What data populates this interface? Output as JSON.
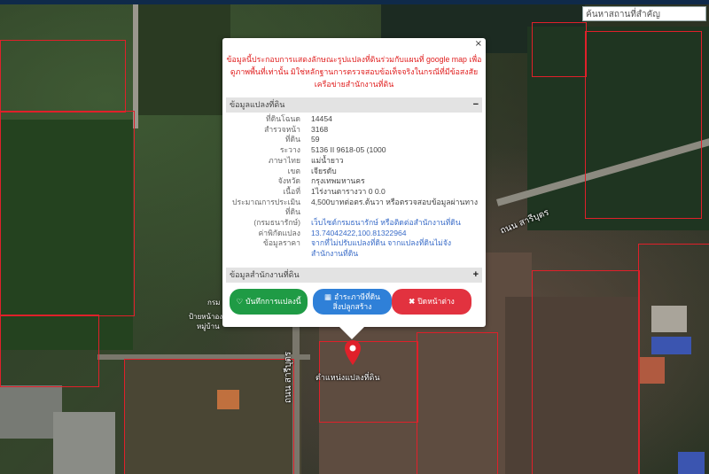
{
  "search": {
    "placeholder": "ค้นหาสถานที่สำคัญ"
  },
  "map": {
    "road_label_right": "ถนน สารีบุตร",
    "road_label_bottom": "ถนน สารีบุตร",
    "side_label_1": "กรม",
    "side_label_2": "ป้ายหน้าองค์การ",
    "side_label_3": "หมู่บ้าน",
    "marker_label": "ตำแหน่งแปลงที่ดิน",
    "marker_color": "#e0202a",
    "parcel_line_color": "#e0202a"
  },
  "popup": {
    "close": "×",
    "notice": "ข้อมูลนี้ประกอบการแสดงลักษณะรูปแปลงที่ดินร่วมกับแผนที่ google map เพื่อดูภาพพื้นที่เท่านั้น มิใช่หลักฐานการตรวจสอบข้อเท็จจริงในกรณีที่มีข้อสงสัยเครือข่ายสำนักงานที่ดิน",
    "section_info": {
      "title": "ข้อมูลแปลงที่ดิน",
      "toggle": "−"
    },
    "rows": [
      {
        "label": "ที่ดินโฉนด",
        "value": "14454"
      },
      {
        "label": "สำรวจหน้า",
        "value": "3168"
      },
      {
        "label": "ที่ดิน",
        "value": "59"
      },
      {
        "label": "ระวาง",
        "value": "5136 II 9618-05 (1000"
      },
      {
        "label": "ภาษาไทย",
        "value": "แม่น้ำยาว"
      },
      {
        "label": "เขต",
        "value": "เจียรดับ"
      },
      {
        "label": "จังหวัด",
        "value": "กรุงเทพมหานคร"
      },
      {
        "label": "เนื้อที่",
        "value": "1ไร่งานตารางวา 0 0.0"
      },
      {
        "label": "ประมาณการประเมินที่ดิน",
        "value": "4,500บาทต่อตร.ต้นวา หรือตรวจสอบข้อมูลผ่านทาง"
      },
      {
        "label": "(กรมธนารักษ์)",
        "value": "เว็บไซต์กรมธนารักษ์ หรือติดต่อสำนักงานที่ดิน"
      },
      {
        "label": "ค่าพิกัดแปลง",
        "value": "13.74042422,100.81322964"
      },
      {
        "label": "ข้อมูลราคา",
        "value": "จากที่ไม่ปรับแปลงที่ดิน จากแปลงที่ดินไม่จัง"
      },
      {
        "label": "",
        "value": "สำนักงานที่ดิน"
      }
    ],
    "section_office": {
      "title": "ข้อมูลสำนักงานที่ดิน",
      "toggle": "+"
    },
    "buttons": {
      "save": "บันทึกการแปลงนี้",
      "calc_line1": "อำระภาษีที่ดิน",
      "calc_line2": "สิ่งปลูกสร้าง",
      "close": "ปิดหน้าต่าง"
    },
    "colors": {
      "notice": "#e02020",
      "link": "#3a6cc8",
      "green": "#1f9b45",
      "blue": "#2f80d8",
      "red": "#e2323f"
    }
  }
}
